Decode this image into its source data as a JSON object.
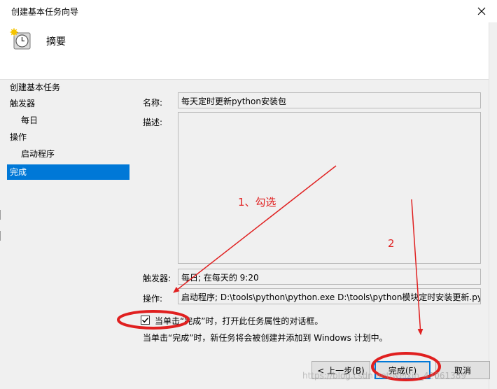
{
  "window": {
    "title": "创建基本任务向导"
  },
  "header": {
    "title": "摘要"
  },
  "sidebar": {
    "items": [
      {
        "label": "创建基本任务"
      },
      {
        "label": "触发器"
      },
      {
        "label": "每日"
      },
      {
        "label": "操作"
      },
      {
        "label": "启动程序"
      },
      {
        "label": "完成"
      }
    ],
    "selected_index": 5
  },
  "form": {
    "name_label": "名称:",
    "name_value": "每天定时更新python安装包",
    "desc_label": "描述:",
    "desc_value": "",
    "trigger_label": "触发器:",
    "trigger_value": "每日; 在每天的 9:20",
    "action_label": "操作:",
    "action_value": "启动程序; D:\\tools\\python\\python.exe D:\\tools\\python模块定时安装更新.py"
  },
  "checkbox": {
    "label": "当单击“完成”时，打开此任务属性的对话框。",
    "checked": true
  },
  "info_text": "当单击“完成”时，新任务将会被创建并添加到 Windows 计划中。",
  "buttons": {
    "back": "< 上一步(B)",
    "finish": "完成(F)",
    "cancel": "取消"
  },
  "annotations": {
    "step1": "1、勾选",
    "step2": "2",
    "color": "#e02020"
  },
  "watermark": "https://blog.csdn.net/weixin_42061389",
  "colors": {
    "selection": "#0078d7",
    "dialog_bg": "#f0f0f0"
  }
}
